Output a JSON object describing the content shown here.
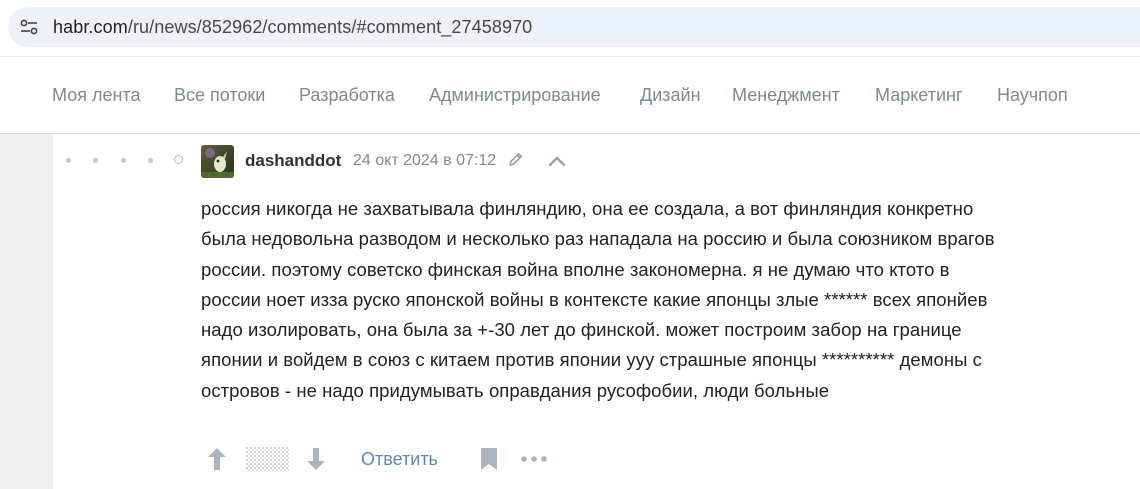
{
  "browser": {
    "url_host": "habr.com",
    "url_path": "/ru/news/852962/comments/#comment_27458970",
    "site_info_icon": "tune-icon"
  },
  "nav": {
    "items": [
      "Моя лента",
      "Все потоки",
      "Разработка",
      "Администрирование",
      "Дизайн",
      "Менеджмент",
      "Маркетинг",
      "Научпоп"
    ]
  },
  "comment": {
    "username": "dashanddot",
    "timestamp": "24 окт 2024 в 07:12",
    "edited_icon": "pencil-icon",
    "collapse_icon": "chevron-up-icon",
    "lines": [
      "россия никогда не захватывала финляндию, она ее создала, а вот финляндия конкретно",
      "была недовольна разводом и несколько раз нападала на россию и была союзником врагов",
      "россии. поэтому советско финская война вполне закономерна. я не думаю что ктото в",
      "россии ноет изза руско японской войны в контексте какие японцы злые ****** всех японйев",
      "надо изолировать, она была за +-30 лет до финской. может построим забор на границе",
      "японии и войдем в союз с китаем против японии ууу страшные японцы ********** демоны с",
      "островов - не надо придумывать оправдания русофобии, люди больные"
    ],
    "actions": {
      "reply_label": "Ответить",
      "upvote_icon": "arrow-up-icon",
      "downvote_icon": "arrow-down-icon",
      "bookmark_icon": "bookmark-icon",
      "more_icon": "more-horizontal-icon"
    }
  },
  "colors": {
    "nav_text": "#7b8a96",
    "reply_link": "#5e8aa8",
    "address_bar_bg": "#edf2fa",
    "page_bg": "#f0f0f0"
  }
}
